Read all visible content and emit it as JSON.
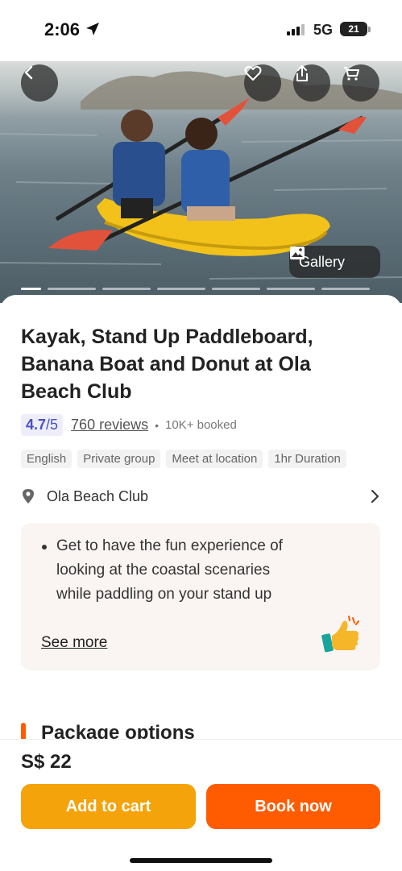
{
  "status": {
    "time": "2:06",
    "network": "5G",
    "battery": "21"
  },
  "hero": {
    "gallery_label": "Gallery"
  },
  "product": {
    "title": "Kayak, Stand Up Paddleboard, Banana Boat and Donut at Ola Beach Club",
    "rating": "4.7",
    "rating_max": "/5",
    "reviews": "760 reviews",
    "booked": "10K+ booked",
    "tags": [
      "English",
      "Private group",
      "Meet at location",
      "1hr Duration"
    ],
    "location": "Ola Beach Club"
  },
  "description": {
    "bullet": "Get to have the fun experience of looking at the coastal scenaries while paddling on your stand up",
    "see_more": "See more"
  },
  "section": {
    "package_options": "Package options"
  },
  "footer": {
    "price": "S$ 22",
    "add_to_cart": "Add to cart",
    "book_now": "Book now"
  },
  "colors": {
    "accent": "#ff5b00",
    "cart": "#f5a30a",
    "rating": "#4b4fc4"
  },
  "icons": [
    "location-arrow-icon",
    "back-icon",
    "heart-icon",
    "share-icon",
    "cart-icon",
    "gallery-icon",
    "location-pin-icon",
    "chevron-right-icon",
    "thumbs-up-icon"
  ]
}
